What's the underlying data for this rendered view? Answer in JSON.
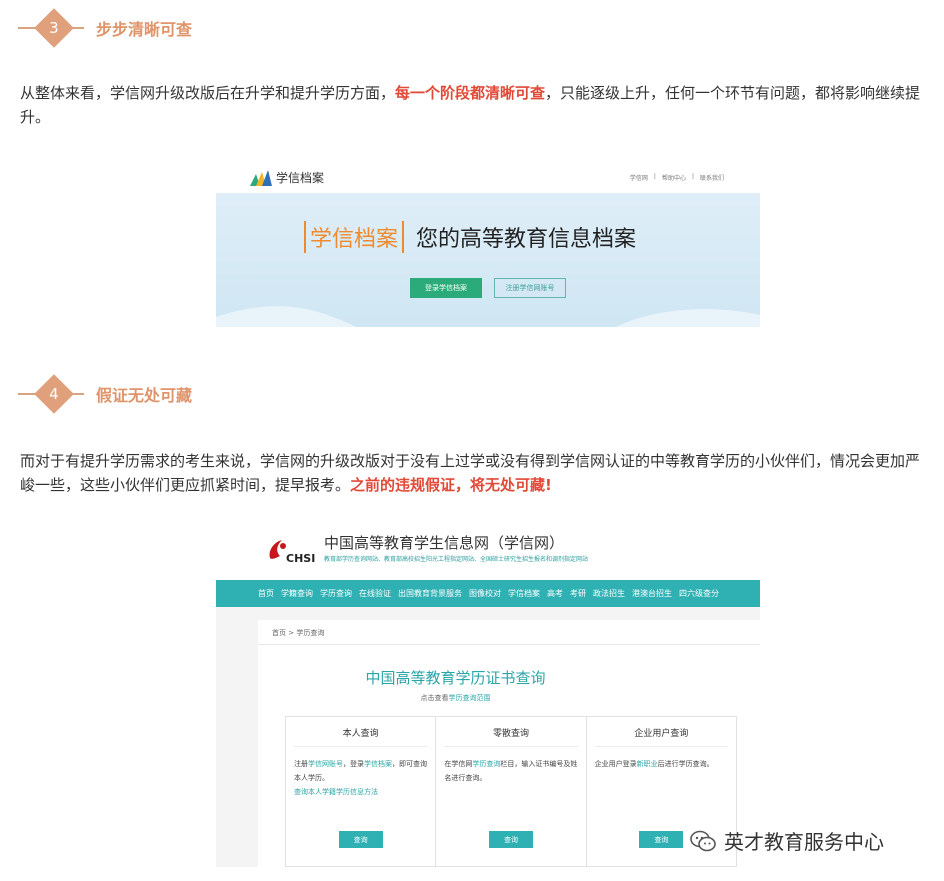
{
  "section3": {
    "number": "3",
    "title": "步步清晰可查"
  },
  "para1": {
    "before": "从整体来看，学信网升级改版后在升学和提升学历方面，",
    "highlight": "每一个阶段都清晰可查",
    "after": "，只能逐级上升，任何一个环节有问题，都将影响继续提升。"
  },
  "shot1": {
    "logo_text": "学信档案",
    "nav": [
      "学信网",
      "帮助中心",
      "联系我们"
    ],
    "brand": "学信档案",
    "slogan": "您的高等教育信息档案",
    "login_button": "登录学信档案",
    "register_button": "注册学信网账号"
  },
  "section4": {
    "number": "4",
    "title": "假证无处可藏"
  },
  "para2": {
    "before": "而对于有提升学历需求的考生来说，学信网的升级改版对于没有上过学或没有得到学信网认证的中等教育学历的小伙伴们，情况会更加严峻一些，这些小伙伴们更应抓紧时间，提早报考。",
    "highlight": "之前的违规假证，将无处可藏!"
  },
  "shot2": {
    "site_title": "中国高等教育学生信息网（学信网）",
    "chsi": "CHSI",
    "site_sub": "教育部学历查询网站、教育部高校招生阳光工程指定网站、全国硕士研究生招生报名和调剂指定网站",
    "nav": [
      "首页",
      "学籍查询",
      "学历查询",
      "在线验证",
      "出国教育背景服务",
      "图像校对",
      "学信档案",
      "高考",
      "考研",
      "政法招生",
      "港澳台招生",
      "四六级查分"
    ],
    "breadcrumb": "首页 > 学历查询",
    "heading": "中国高等教育学历证书查询",
    "hint_before": "点击查看",
    "hint_link": "学历查询范围",
    "cards": [
      {
        "title": "本人查询",
        "desc_1": "注册",
        "link_1": "学信网账号",
        "desc_2": "，登录",
        "link_2": "学信档案",
        "desc_3": "，即可查询本人学历。",
        "link_3": "查询本人学籍学历信息方法",
        "button": "查询"
      },
      {
        "title": "零散查询",
        "desc_1": "在学信网",
        "link_1": "学历查询",
        "desc_2": "栏目，输入证书编号及姓名进行查询。",
        "button": "查询"
      },
      {
        "title": "企业用户查询",
        "desc_1": "企业用户登录",
        "link_1": "新职业",
        "desc_2": "后进行学历查询。",
        "button": "查询"
      }
    ]
  },
  "watermark": {
    "text": "英才教育服务中心"
  },
  "colors": {
    "accent": "#e0946a",
    "highlight": "#e24a38",
    "teal": "#2fb1b4",
    "green": "#2bab7a"
  }
}
